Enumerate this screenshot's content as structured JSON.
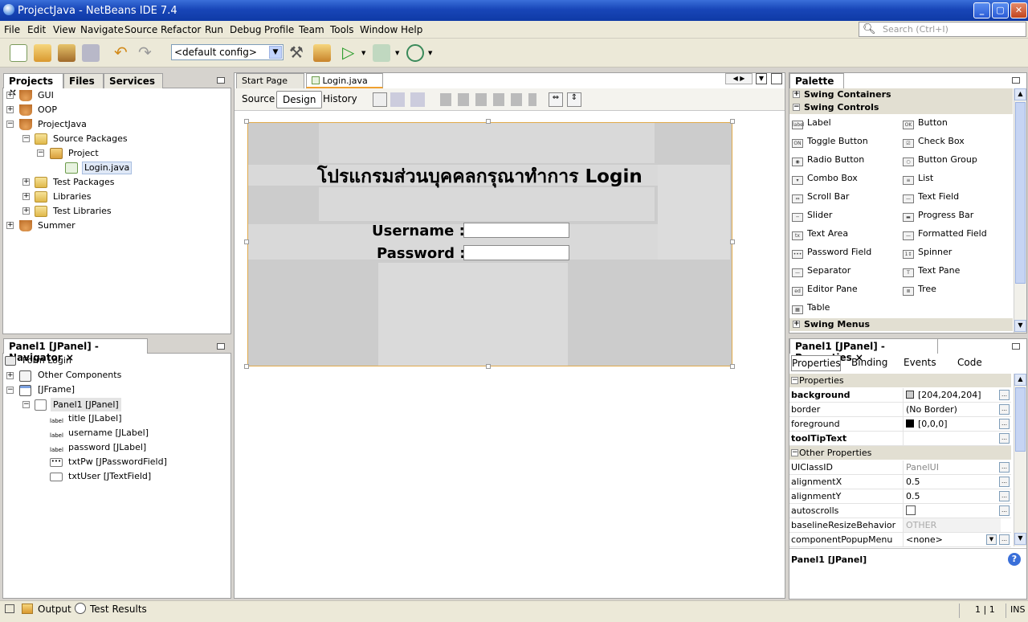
{
  "window": {
    "title": "ProjectJava - NetBeans IDE 7.4"
  },
  "menu": [
    "File",
    "Edit",
    "View",
    "Navigate",
    "Source",
    "Refactor",
    "Run",
    "Debug",
    "Profile",
    "Team",
    "Tools",
    "Window",
    "Help"
  ],
  "search": {
    "placeholder": "Search (Ctrl+I)"
  },
  "toolbar": {
    "config": "<default config>"
  },
  "projects": {
    "tabs": [
      "Projects",
      "Files",
      "Services"
    ],
    "tree": [
      "GUI",
      "OOP",
      "ProjectJava",
      "Source Packages",
      "Project",
      "Login.java",
      "Test Packages",
      "Libraries",
      "Test Libraries",
      "Summer"
    ]
  },
  "navigator": {
    "title": "Panel1 [JPanel] - Navigator",
    "tree": [
      "Form Login",
      "Other Components",
      "[JFrame]",
      "Panel1 [JPanel]",
      "title [JLabel]",
      "username [JLabel]",
      "password [JLabel]",
      "txtPw [JPasswordField]",
      "txtUser [JTextField]"
    ]
  },
  "editor": {
    "tabs": [
      "Start Page",
      "Login.java"
    ],
    "views": [
      "Source",
      "Design",
      "History"
    ],
    "form": {
      "title": "โปรแกรมส่วนบุคคลกรุณาทำการ Login",
      "username_label": "Username :",
      "password_label": "Password :"
    }
  },
  "palette": {
    "title": "Palette",
    "categories": [
      "Swing Containers",
      "Swing Controls",
      "Swing Menus"
    ],
    "left": [
      "Label",
      "Toggle Button",
      "Radio Button",
      "Combo Box",
      "Scroll Bar",
      "Slider",
      "Text Area",
      "Password Field",
      "Separator",
      "Editor Pane",
      "Table"
    ],
    "right": [
      "Button",
      "Check Box",
      "Button Group",
      "List",
      "Text Field",
      "Progress Bar",
      "Formatted Field",
      "Spinner",
      "Text Pane",
      "Tree"
    ],
    "left_icons": [
      "label",
      "ON",
      "◉",
      "▾",
      "⇔",
      "─",
      "tx",
      "•••",
      "—",
      "ed",
      "▦"
    ],
    "right_icons": [
      "OK",
      "☑",
      "○",
      "≡",
      "—",
      "▬",
      "—",
      "1↕",
      "T",
      "≣"
    ]
  },
  "properties": {
    "title": "Panel1 [JPanel] - Properties",
    "tabs": [
      "Properties",
      "Binding",
      "Events",
      "Code"
    ],
    "section1": "Properties",
    "section2": "Other Properties",
    "rows1": [
      {
        "name": "background",
        "value": "[204,204,204]"
      },
      {
        "name": "border",
        "value": "(No Border)"
      },
      {
        "name": "foreground",
        "value": "[0,0,0]"
      },
      {
        "name": "toolTipText",
        "value": ""
      }
    ],
    "rows2": [
      {
        "name": "UIClassID",
        "value": "PanelUI"
      },
      {
        "name": "alignmentX",
        "value": "0.5"
      },
      {
        "name": "alignmentY",
        "value": "0.5"
      },
      {
        "name": "autoscrolls",
        "value": ""
      },
      {
        "name": "baselineResizeBehavior",
        "value": "OTHER"
      },
      {
        "name": "componentPopupMenu",
        "value": "<none>"
      }
    ],
    "footer": "Panel1 [JPanel]"
  },
  "status": {
    "output": "Output",
    "tests": "Test Results",
    "pos": "1 | 1",
    "mode": "INS"
  },
  "colors": {
    "titlebar": "#1846b8",
    "chrome": "#ece9d8",
    "formbg": "#cccccc"
  }
}
